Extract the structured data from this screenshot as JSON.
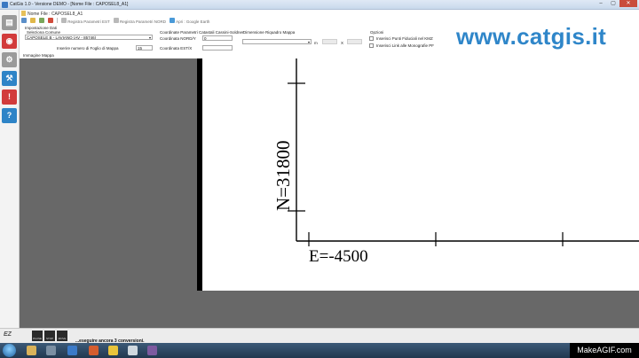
{
  "window": {
    "title": "CatGis 1.0 - Versione DEMO - [Nome File : CAPOSEL8_A1]",
    "buttons": {
      "minimize": "–",
      "maximize": "▢",
      "close": "✕"
    }
  },
  "file": {
    "title": "Nome File : CAPOSEL8_A1"
  },
  "toolbar": {
    "items": [
      {
        "label": "Registra Parametri EST"
      },
      {
        "label": "Registra Parametri NORD"
      },
      {
        "label": "Apri : Google Earth"
      }
    ]
  },
  "settings": {
    "section_label": "Impostazione Dati",
    "comune_label": "Seleziona Comune",
    "comune_value": "CAPOSELE B - LAVIANO (AV - 85746)",
    "foglio_label": "Inserire numero di Foglio di Mappa",
    "foglio_value": "15"
  },
  "coords": {
    "section_label": "Coordinate Parametri Catastali Cassini-Soldner",
    "nord_label": "Coordinata NORD/Y",
    "nord_value": "0",
    "est_label": "Coordinata EST/X",
    "est_value": ""
  },
  "dimension": {
    "section_label": "Dimensione Riquadro Mappa",
    "value": "",
    "unit": "m",
    "separator": "X"
  },
  "options": {
    "section_label": "Opzioni",
    "items": [
      {
        "label": "Inserisci Punti Fiduciali nel KMZ",
        "checked": false
      },
      {
        "label": "Inserisci Link alle Monografie PF",
        "checked": false
      }
    ]
  },
  "brand": {
    "text": "www.catgis.it",
    "color": "#2f86c9"
  },
  "map": {
    "label": "Immagine Mappa",
    "north_label": "N=31800",
    "east_label": "E=-4500"
  },
  "status": {
    "message": "...eseguire ancora 3 conversioni.",
    "logo_text": "EZ",
    "thumbnails": [
      "PAUSE",
      "STOP",
      "MOVE"
    ]
  },
  "sidebar": {
    "buttons": [
      {
        "icon": "table-icon",
        "color": "#9a9a9a"
      },
      {
        "icon": "globe-icon",
        "color": "#d23b3b"
      },
      {
        "icon": "settings-icon",
        "color": "#9a9a9a"
      },
      {
        "icon": "tools-icon",
        "color": "#2e84c7"
      },
      {
        "icon": "info-icon",
        "color": "#d23b3b"
      },
      {
        "icon": "help-icon",
        "color": "#2e84c7"
      }
    ]
  },
  "watermark": {
    "text": "MakeAGIF.com"
  }
}
